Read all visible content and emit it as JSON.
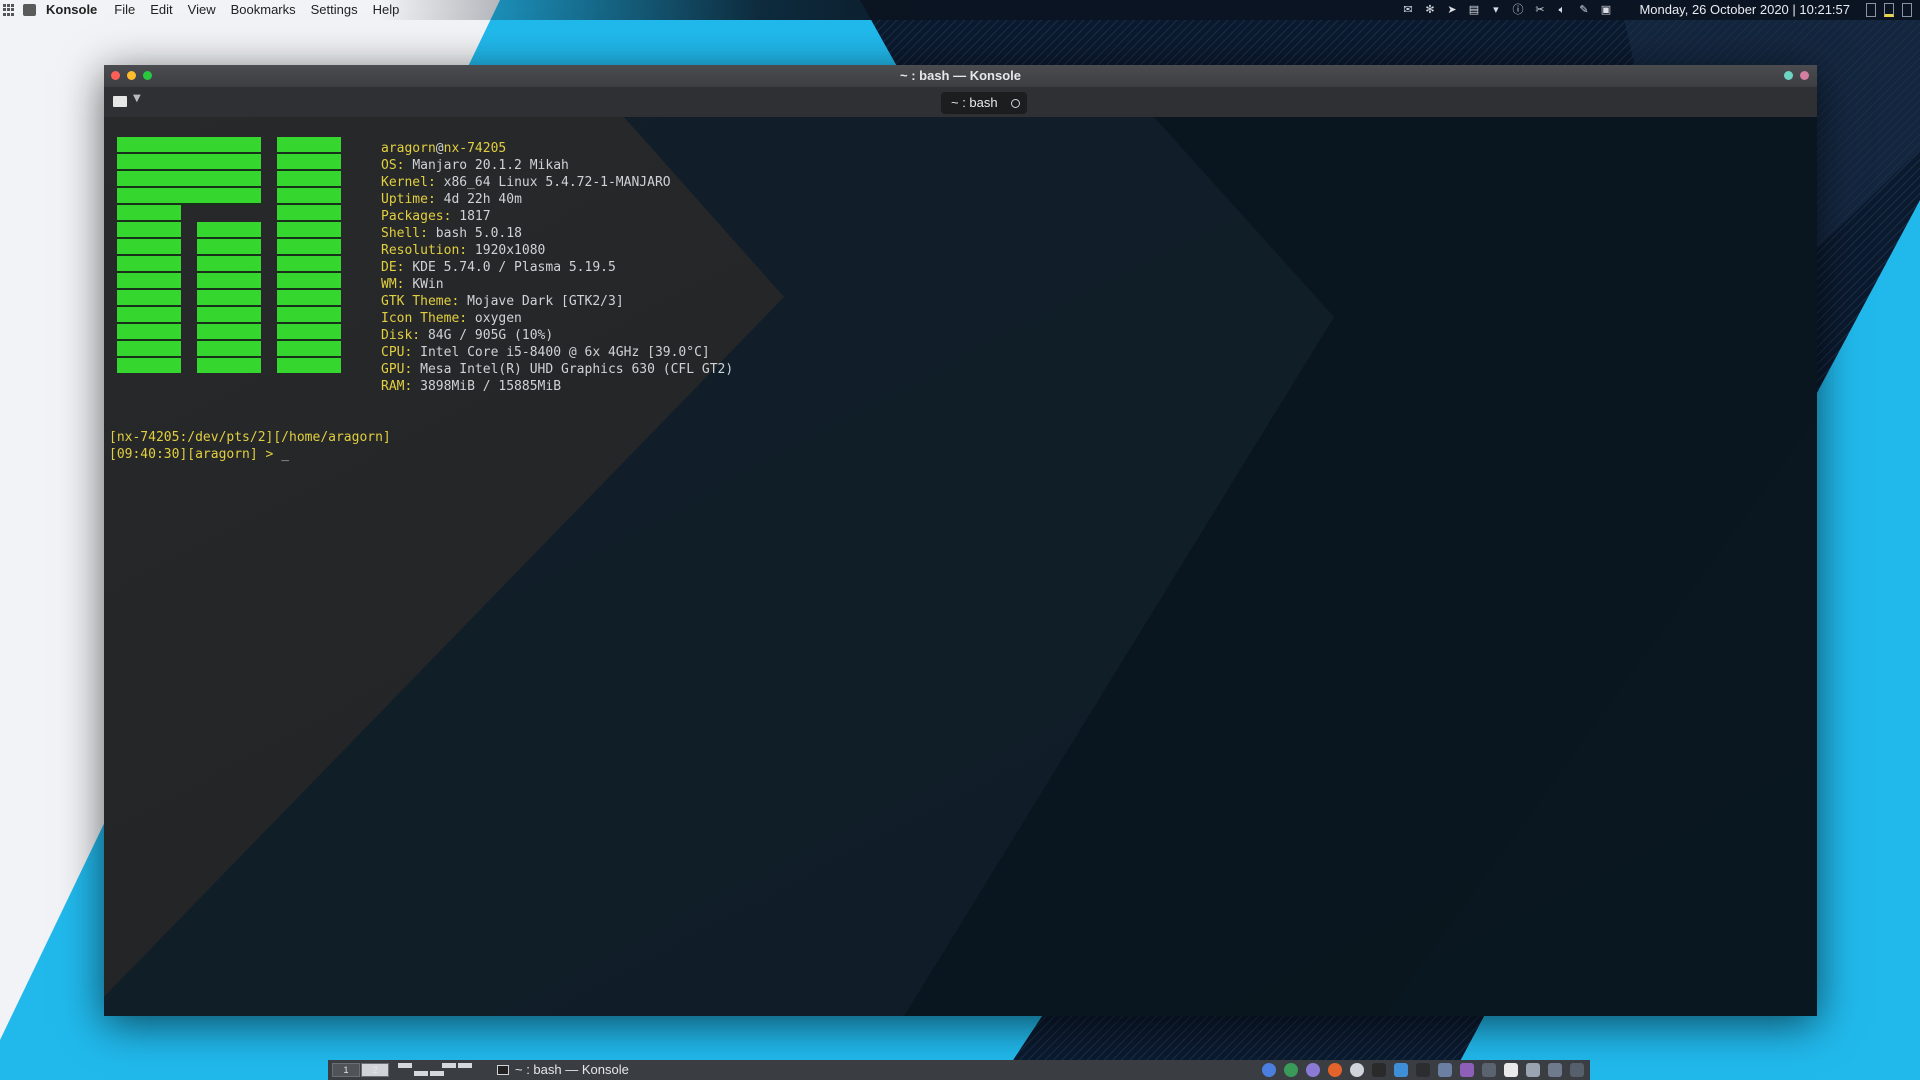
{
  "top_panel": {
    "app_name": "Konsole",
    "menu": [
      "File",
      "Edit",
      "View",
      "Bookmarks",
      "Settings",
      "Help"
    ],
    "tray_icons": [
      "mail-icon",
      "settings-icon",
      "telegram-icon",
      "chat-icon",
      "expand-arrow-icon",
      "info-icon",
      "scissors-icon",
      "volume-icon",
      "notes-icon",
      "clipboard-icon"
    ],
    "clock": "Monday, 26 October 2020 | 10:21:57"
  },
  "window": {
    "title": "~ : bash — Konsole",
    "tab_label": "~ : bash"
  },
  "terminal": {
    "user": "aragorn",
    "at": "@",
    "host": "nx-74205",
    "info": [
      {
        "key": "OS:",
        "value": "Manjaro 20.1.2 Mikah"
      },
      {
        "key": "Kernel:",
        "value": "x86_64 Linux 5.4.72-1-MANJARO"
      },
      {
        "key": "Uptime:",
        "value": "4d 22h 40m"
      },
      {
        "key": "Packages:",
        "value": "1817"
      },
      {
        "key": "Shell:",
        "value": "bash 5.0.18"
      },
      {
        "key": "Resolution:",
        "value": "1920x1080"
      },
      {
        "key": "DE:",
        "value": "KDE 5.74.0 / Plasma 5.19.5"
      },
      {
        "key": "WM:",
        "value": "KWin"
      },
      {
        "key": "GTK Theme:",
        "value": "Mojave Dark [GTK2/3]"
      },
      {
        "key": "Icon Theme:",
        "value": "oxygen"
      },
      {
        "key": "Disk:",
        "value": "84G / 905G (10%)"
      },
      {
        "key": "CPU:",
        "value": "Intel Core i5-8400 @ 6x 4GHz [39.0°C]"
      },
      {
        "key": "GPU:",
        "value": "Mesa Intel(R) UHD Graphics 630 (CFL GT2)"
      },
      {
        "key": "RAM:",
        "value": "3898MiB / 15885MiB"
      }
    ],
    "prompt_line1": "[nx-74205:/dev/pts/2][/home/aragorn]",
    "prompt_line2": "[09:40:30][aragorn] > ",
    "cursor": "_"
  },
  "bottom_panel": {
    "pager": [
      "1",
      "2"
    ],
    "task_title": "~ : bash — Konsole",
    "launchers": [
      "chrome-icon",
      "feather-icon",
      "browser-icon",
      "firefox-icon",
      "circle-app-icon",
      "inkscape-icon",
      "people-icon",
      "terminal-icon",
      "files-icon",
      "apps-icon",
      "calculator-icon",
      "font-icon",
      "trash-icon",
      "monitor-icon",
      "disk-icon"
    ]
  },
  "colors": {
    "logo_green": "#35d62d",
    "key_yellow": "#e2cf3f",
    "wallpaper_blue": "#21b9ec",
    "wallpaper_navy": "#0b1628"
  }
}
